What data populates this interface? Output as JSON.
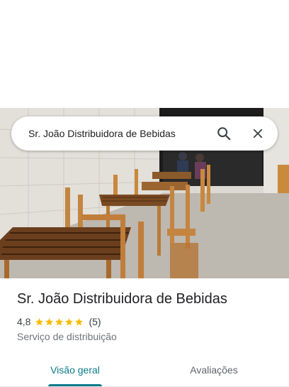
{
  "search": {
    "query": "Sr. João Distribuidora de Bebidas",
    "search_icon": "search-icon",
    "close_icon": "close-icon"
  },
  "photo": {
    "description_icon": "place-photo"
  },
  "place": {
    "name": "Sr. João Distribuidora de Bebidas",
    "rating": "4,8",
    "rating_value": 4.8,
    "stars_max": 5,
    "review_count": "(5)",
    "category": "Serviço de distribuição"
  },
  "tabs": [
    {
      "label": "Visão geral",
      "active": true
    },
    {
      "label": "Avaliações",
      "active": false
    }
  ],
  "colors": {
    "accent": "#0b7a88",
    "star": "#fbbc04",
    "text": "#202124",
    "secondary": "#70757a"
  }
}
